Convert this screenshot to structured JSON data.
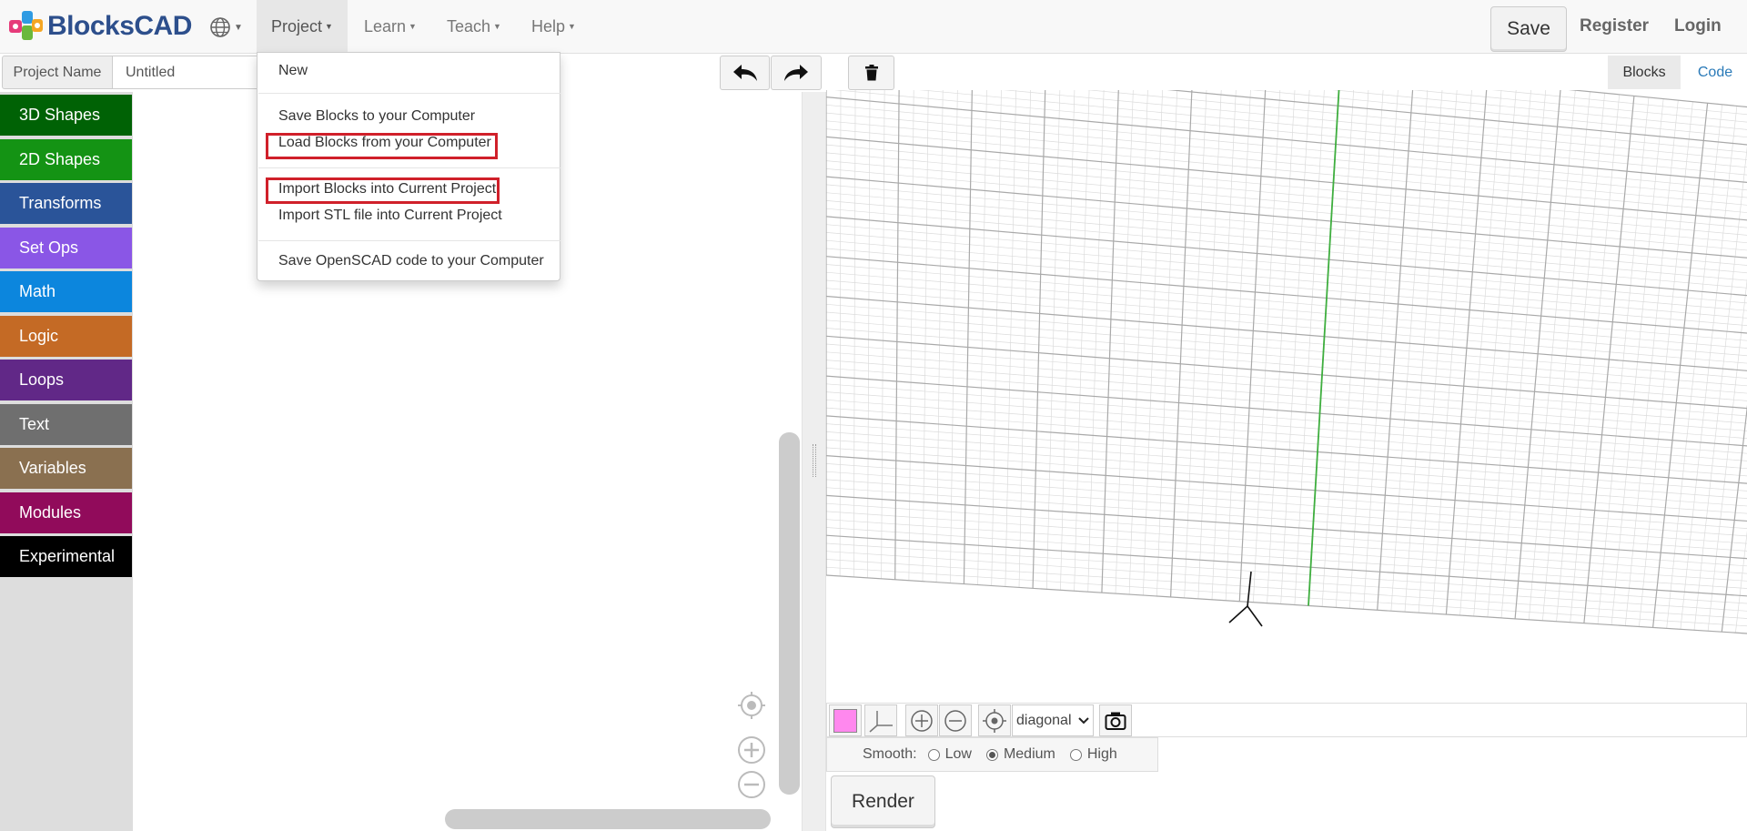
{
  "app": {
    "logo_text": "BlocksCAD",
    "colors": {
      "brand_blue": "#2d4f8c",
      "highlight_red": "#d0202a"
    }
  },
  "nav": {
    "language_icon": "globe-icon",
    "menus": [
      {
        "label": "Project",
        "active": true
      },
      {
        "label": "Learn"
      },
      {
        "label": "Teach"
      },
      {
        "label": "Help"
      }
    ],
    "save": "Save",
    "register": "Register",
    "login": "Login"
  },
  "project": {
    "name_label": "Project Name",
    "name_value": "Untitled"
  },
  "toolbar": {
    "undo_icon": "undo-icon",
    "redo_icon": "redo-icon",
    "trash_icon": "trash-icon"
  },
  "view_tabs": {
    "blocks": "Blocks",
    "code": "Code"
  },
  "categories": [
    {
      "label": "3D Shapes",
      "color": "#006205"
    },
    {
      "label": "2D Shapes",
      "color": "#149314"
    },
    {
      "label": "Transforms",
      "color": "#2a5499"
    },
    {
      "label": "Set Ops",
      "color": "#8a56e6"
    },
    {
      "label": "Math",
      "color": "#0c86dd"
    },
    {
      "label": "Logic",
      "color": "#c46a25"
    },
    {
      "label": "Loops",
      "color": "#612887"
    },
    {
      "label": "Text",
      "color": "#6f6f6f"
    },
    {
      "label": "Variables",
      "color": "#8a7050"
    },
    {
      "label": "Modules",
      "color": "#910b5b"
    },
    {
      "label": "Experimental",
      "color": "#000000"
    }
  ],
  "project_menu": {
    "items": [
      {
        "label": "New"
      },
      {
        "label": "Save Blocks to your Computer"
      },
      {
        "label": "Load Blocks from your Computer",
        "highlighted": true
      },
      {
        "label": "Import Blocks into Current Project",
        "highlighted": true
      },
      {
        "label": "Import STL file into Current Project"
      },
      {
        "label": "Save OpenSCAD code to your Computer"
      }
    ]
  },
  "viewer": {
    "object_color": "#ff88ee",
    "view_options": [
      "diagonal"
    ],
    "view_selected": "diagonal",
    "smooth_label": "Smooth:",
    "smooth_options": [
      {
        "label": "Low",
        "selected": false
      },
      {
        "label": "Medium",
        "selected": true
      },
      {
        "label": "High",
        "selected": false
      }
    ],
    "render": "Render"
  }
}
